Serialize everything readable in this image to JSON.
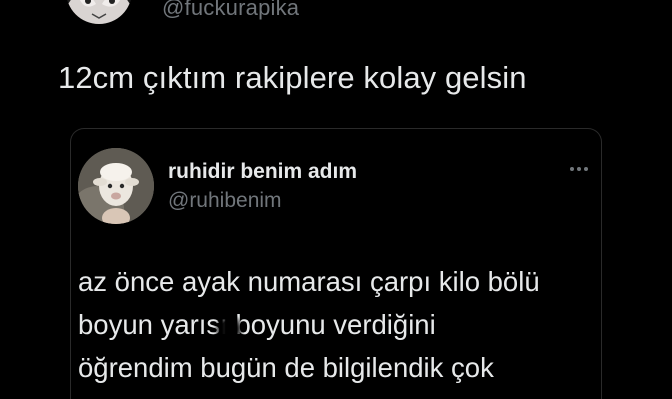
{
  "tweet": {
    "handle": "@fuckurapika",
    "text": "12cm çıktım rakiplere kolay gelsin"
  },
  "quoted_tweet": {
    "name": "ruhidir benim adım",
    "handle": "@ruhibenim",
    "body_lines": [
      "az önce ayak numarası çarpı kilo bölü",
      "boyun yarısı boyunu verdiğini",
      "öğrendim bugün de bilgilendik çok"
    ]
  },
  "icons": {
    "top_avatar": "anime-avatar-icon",
    "quoted_avatar": "sheep-avatar-icon",
    "more": "more-horizontal-icon"
  }
}
